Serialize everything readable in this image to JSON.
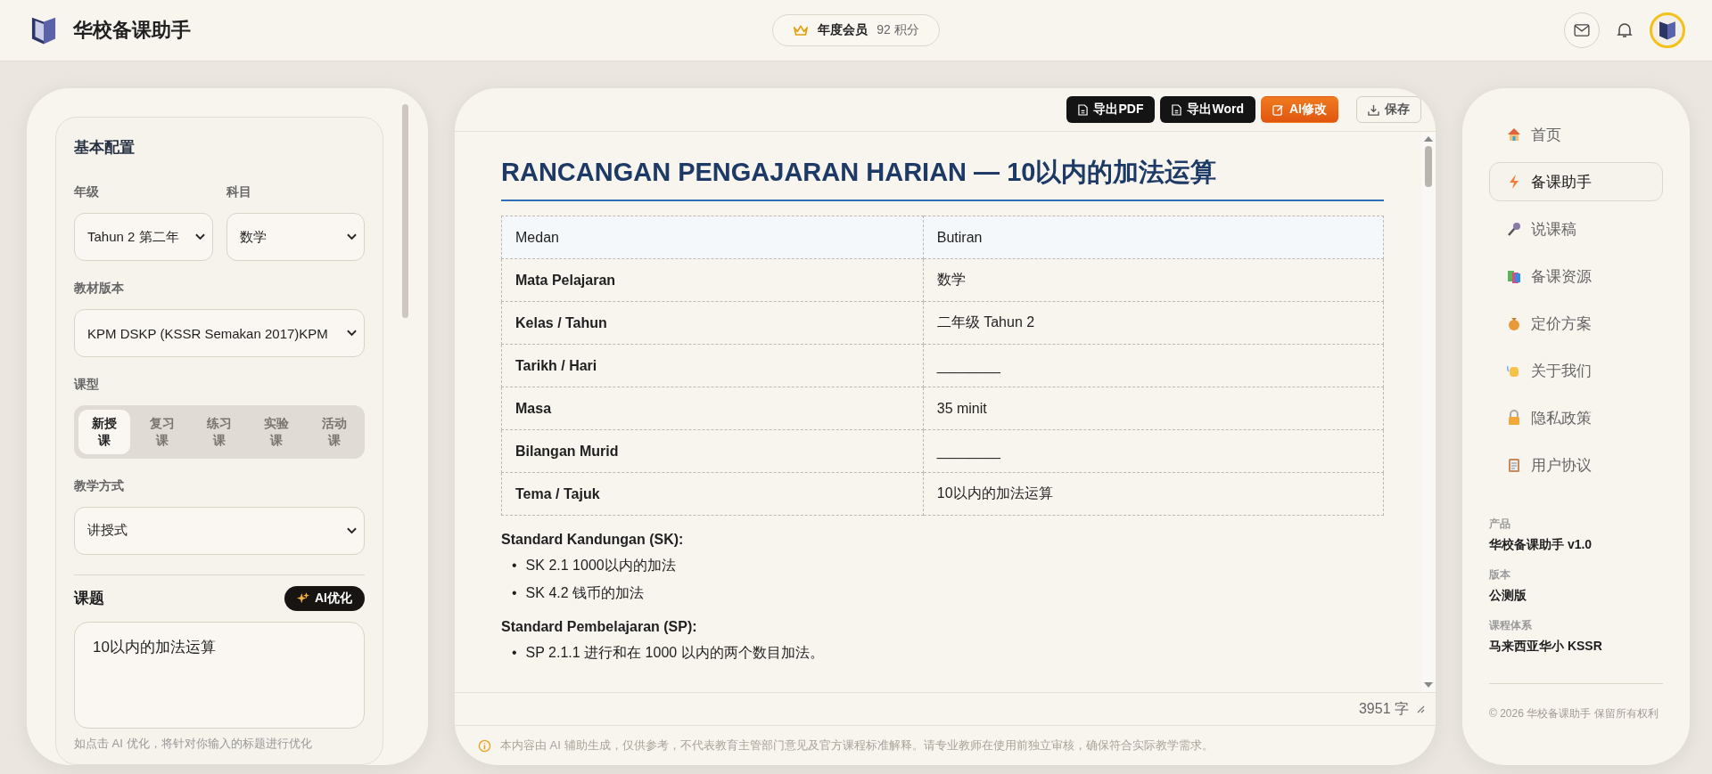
{
  "header": {
    "app_name": "华校备课助手",
    "membership": {
      "label": "年度会员",
      "points": "92 积分"
    }
  },
  "config": {
    "title": "基本配置",
    "fields": [
      {
        "label": "年级",
        "value": "Tahun 2  第二年"
      },
      {
        "label": "科目",
        "value": "数学"
      },
      {
        "label": "教材版本",
        "value": "KPM DSKP (KSSR Semakan 2017)KPM"
      }
    ],
    "lesson_type": {
      "label": "课型",
      "options": [
        {
          "label": "新授课",
          "selected": true
        },
        {
          "label": "复习课",
          "selected": false
        },
        {
          "label": "练习课",
          "selected": false
        },
        {
          "label": "实验课",
          "selected": false
        },
        {
          "label": "活动课",
          "selected": false
        }
      ]
    },
    "method": {
      "label": "教学方式",
      "value": "讲授式"
    },
    "topic": {
      "label": "课题",
      "button": "AI优化",
      "value": "10以内的加法运算",
      "hint": "如点击 AI 优化，将针对你输入的标题进行优化"
    }
  },
  "toolbar": [
    {
      "label": "导出PDF",
      "kind": "dark"
    },
    {
      "label": "导出Word",
      "kind": "dark"
    },
    {
      "label": "AI修改",
      "kind": "accent"
    },
    {
      "label": "保存",
      "kind": "outline"
    }
  ],
  "document": {
    "title": "RANCANGAN PENGAJARAN HARIAN — 10以内的加法运算",
    "table": {
      "columns": [
        "Medan",
        "Butiran"
      ],
      "rows": [
        [
          "Mata Pelajaran",
          "数学"
        ],
        [
          "Kelas / Tahun",
          "二年级 Tahun 2"
        ],
        [
          "Tarikh / Hari",
          "________"
        ],
        [
          "Masa",
          "35 minit"
        ],
        [
          "Bilangan Murid",
          "________"
        ],
        [
          "Tema / Tajuk",
          "10以内的加法运算"
        ]
      ]
    },
    "sections": [
      {
        "heading": "Standard Kandungan (SK):",
        "marker": "•",
        "items": [
          "SK 2.1 1000以内的加法",
          "SK 4.2 钱币的加法"
        ]
      },
      {
        "heading": "Standard Pembelajaran (SP):",
        "marker": "•",
        "items": [
          "SP 2.1.1 进行和在 1000 以内的两个数目加法。"
        ]
      }
    ]
  },
  "word_count": "3951 字",
  "notice": "本内容由 AI 辅助生成，仅供参考，不代表教育主管部门意见及官方课程标准解释。请专业教师在使用前独立审核，确保符合实际教学需求。",
  "nav": [
    {
      "label": "首页",
      "selected": false
    },
    {
      "label": "备课助手",
      "selected": true
    },
    {
      "label": "说课稿",
      "selected": false
    },
    {
      "label": "备课资源",
      "selected": false
    },
    {
      "label": "定价方案",
      "selected": false
    },
    {
      "label": "关于我们",
      "selected": false
    },
    {
      "label": "隐私政策",
      "selected": false
    },
    {
      "label": "用户协议",
      "selected": false
    }
  ],
  "info": [
    {
      "label": "产品",
      "value": "华校备课助手 v1.0"
    },
    {
      "label": "版本",
      "value": "公测版"
    },
    {
      "label": "课程体系",
      "value": "马来西亚华小 KSSR"
    }
  ],
  "copyright": "© 2026 华校备课助手 保留所有权利"
}
